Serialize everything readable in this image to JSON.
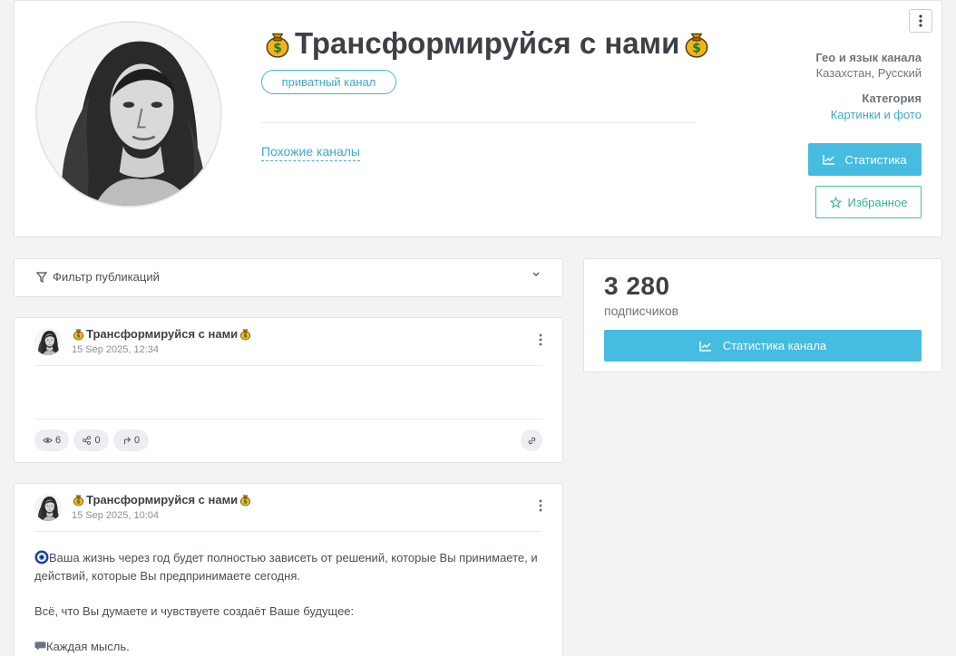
{
  "channel": {
    "title": "Трансформируйся с нами",
    "badge": "приватный канал",
    "similar_link": "Похожие каналы",
    "geo_label": "Гео и язык канала",
    "geo_value": "Казахстан, Русский",
    "category_label": "Категория",
    "category_value": "Картинки и фото",
    "stats_button": "Статистика",
    "favorite_button": "Избранное"
  },
  "filter": {
    "label": "Фильтр публикаций"
  },
  "subscribers": {
    "count": "3 280",
    "label": "подписчиков",
    "button": "Статистика канала"
  },
  "posts": [
    {
      "title": "Трансформируйся с нами",
      "date": "15 Sep 2025, 12:34",
      "views": "6",
      "shares": "0",
      "forwards": "0"
    },
    {
      "title": "Трансформируйся с нами",
      "date": "15 Sep 2025, 10:04",
      "text_1": "Ваша жизнь через год будет полностью зависеть от решений, которые Вы принимаете, и действий, которые Вы предпринимаете сегодня.",
      "text_2": "Всё, что Вы думаете и чувствуете создаёт Ваше будущее:",
      "text_3": "Каждая мысль."
    }
  ],
  "colors": {
    "accent": "#45bce0",
    "favorite": "#3cc49a",
    "link": "#3fa9c9",
    "background": "#f2f3f5"
  },
  "icons": [
    "moneybag-icon",
    "kebab-icon",
    "chart-icon",
    "star-icon",
    "filter-icon",
    "chevron-down-icon",
    "eye-icon",
    "share-icon",
    "forward-icon",
    "link-icon",
    "nazar-icon",
    "speech-bubble-icon"
  ]
}
